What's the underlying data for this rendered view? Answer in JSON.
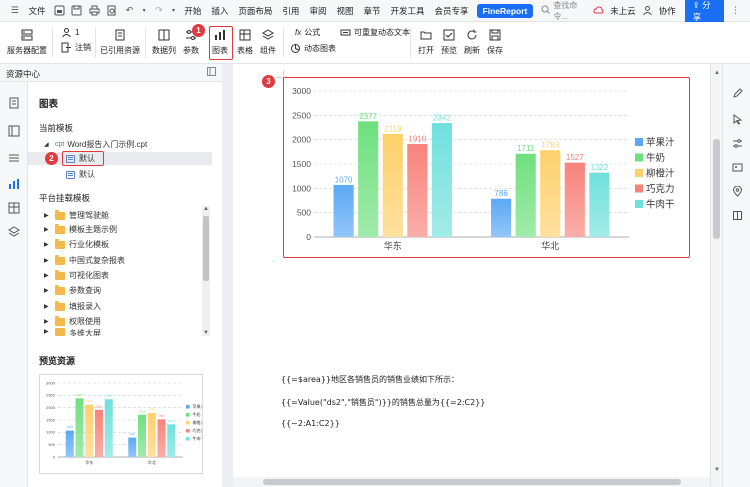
{
  "menubar": {
    "file": "文件",
    "tabs": [
      "开始",
      "插入",
      "页面布局",
      "引用",
      "审阅",
      "视图",
      "章节",
      "开发工具",
      "会员专享"
    ],
    "finereport": "FineReport",
    "search_placeholder": "查找命令...",
    "cloud_status": "未上云",
    "collab": "协作",
    "share": "分享"
  },
  "ribbon": {
    "server_config": "服务器配置",
    "user_count": "1",
    "logout": "注销",
    "cited_resources": "已引用资源",
    "dataset": "数据列",
    "params": "参数",
    "chart": "图表",
    "table": "表格",
    "widget": "组件",
    "formula": "公式",
    "repeatable_dynamic_text": "可重复动态文本",
    "dynamic_chart": "动态图表",
    "open": "打开",
    "preview": "预览",
    "refresh": "刷新",
    "save": "保存"
  },
  "badges": [
    "1",
    "2",
    "3"
  ],
  "resource_center": {
    "header": "资源中心",
    "section_title": "图表",
    "current_template_label": "当前模板",
    "template_file_prefix": "cpt",
    "template_file": "Word报告入门示例.cpt",
    "chart_items": [
      "默认",
      "默认"
    ],
    "platform_label": "平台挂载模板",
    "folders": [
      "管理驾驶舱",
      "模板主题示例",
      "行业化模板",
      "中国式复杂报表",
      "可视化图表",
      "参数查询",
      "填报录入",
      "权限使用",
      "多维大屏"
    ],
    "preview_label": "预览资源"
  },
  "report_lines": [
    "{{=$area}}地区各销售员的销售业绩如下所示：",
    "{{=Value(\"ds2\",\"销售员\")}}的销售总量为{{=2:C2}}",
    "{{~2:A1:C2}}"
  ],
  "colors": {
    "accent": "#1a6ef2",
    "highlight": "#e0393e",
    "series": [
      "#5aa8f5",
      "#6ee07e",
      "#fdd06a",
      "#f7837b",
      "#70e0dc"
    ]
  },
  "chart_data": {
    "type": "bar",
    "categories": [
      "华东",
      "华北"
    ],
    "series": [
      {
        "name": "苹果汁",
        "values": [
          1070,
          786
        ]
      },
      {
        "name": "牛奶",
        "values": [
          2377,
          1711
        ]
      },
      {
        "name": "柳橙汁",
        "values": [
          2119,
          1783
        ]
      },
      {
        "name": "巧克力",
        "values": [
          1910,
          1527
        ]
      },
      {
        "name": "牛肉干",
        "values": [
          2342,
          1322
        ]
      }
    ],
    "yticks": [
      0,
      500,
      1000,
      1500,
      2000,
      2500,
      3000
    ],
    "ylim": [
      0,
      3000
    ],
    "grid": true,
    "legend_position": "right"
  },
  "preview_chart_data": {
    "type": "bar",
    "categories": [
      "华东",
      "华北"
    ],
    "series": [
      {
        "name": "苹果汁",
        "values": [
          1070,
          786
        ]
      },
      {
        "name": "牛奶",
        "values": [
          2377,
          1711
        ]
      },
      {
        "name": "柳橙汁",
        "values": [
          2119,
          1783
        ]
      },
      {
        "name": "巧克力",
        "values": [
          1910,
          1527
        ]
      },
      {
        "name": "牛肉干",
        "values": [
          2342,
          1322
        ]
      }
    ],
    "yticks": [
      0,
      500,
      1000,
      1500,
      2000,
      2500,
      3000
    ],
    "ylim": [
      0,
      3000
    ]
  }
}
